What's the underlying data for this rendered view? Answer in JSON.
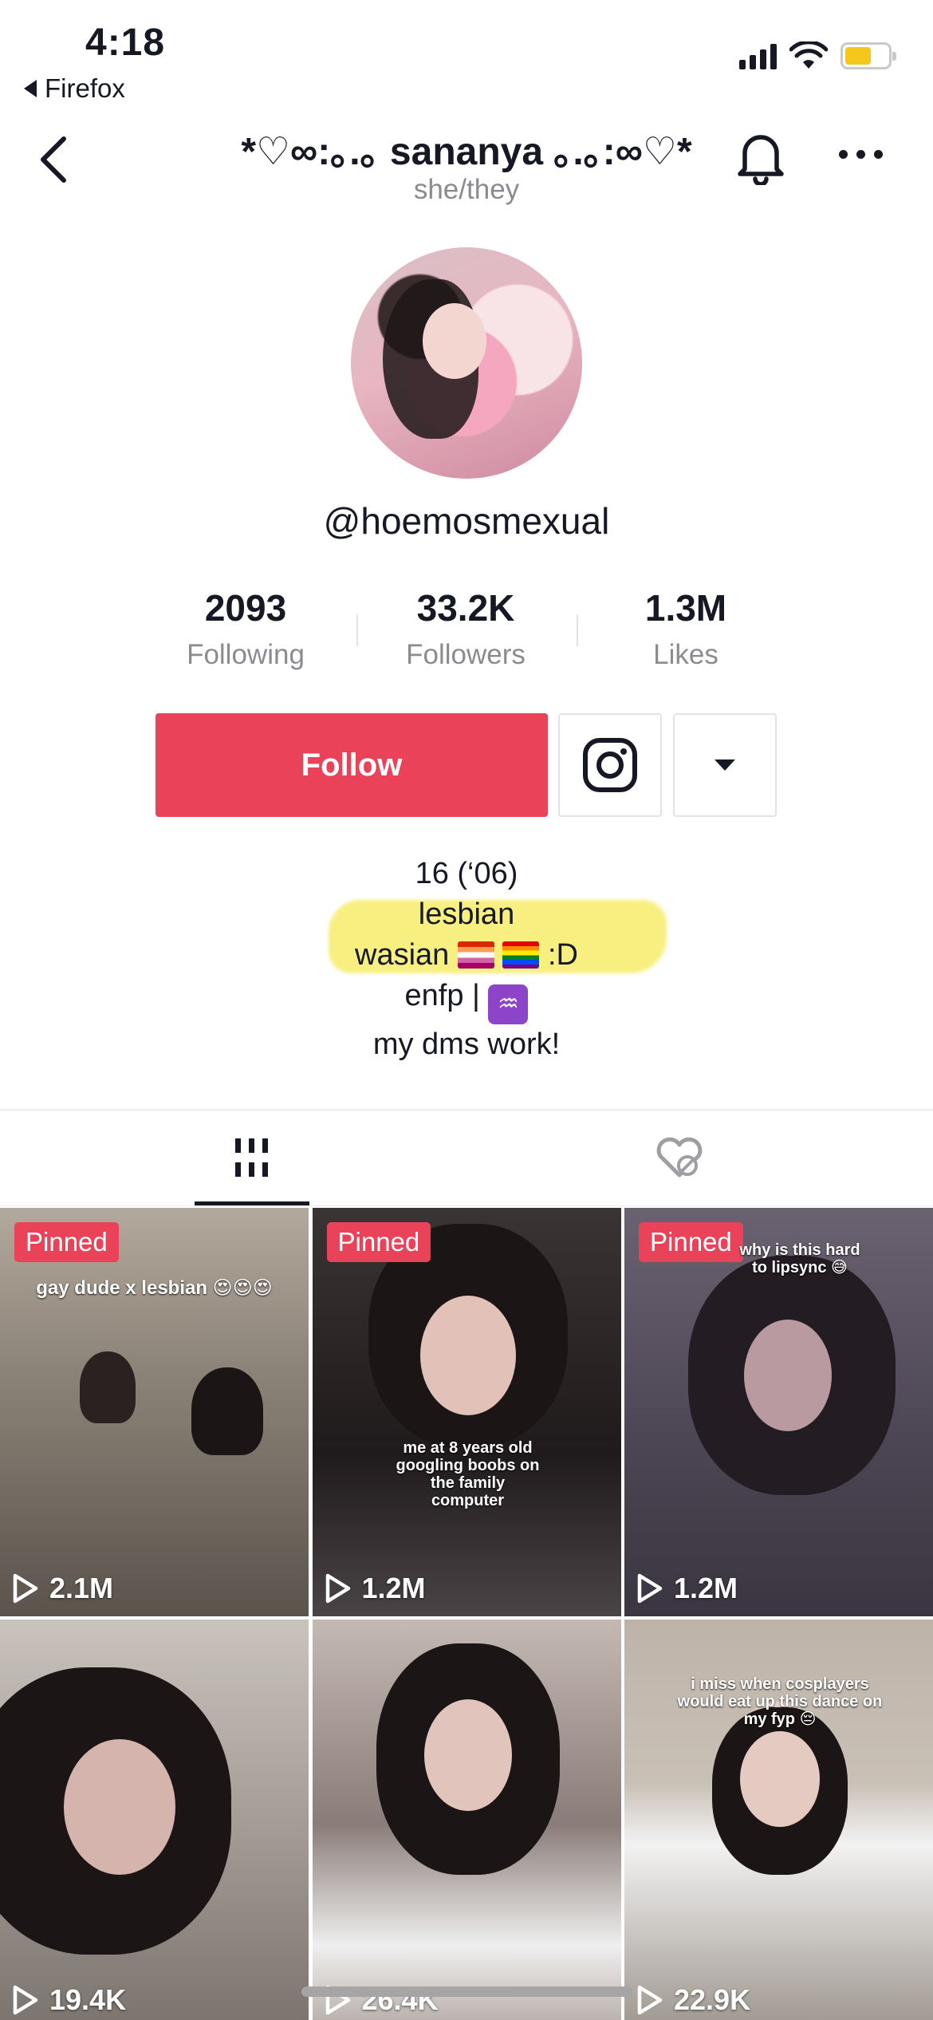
{
  "status_bar": {
    "time": "4:18",
    "back_app": "Firefox",
    "battery_color": "#f5c71a"
  },
  "header": {
    "title": "*♡∞:｡.｡ sananya ｡.｡:∞♡*",
    "pronouns": "she/they",
    "icons": [
      "back-chevron-icon",
      "bell-icon",
      "more-icon"
    ]
  },
  "profile": {
    "handle": "@hoemosmexual",
    "stats": [
      {
        "value": "2093",
        "label": "Following"
      },
      {
        "value": "33.2K",
        "label": "Followers"
      },
      {
        "value": "1.3M",
        "label": "Likes"
      }
    ]
  },
  "actions": {
    "follow_label": "Follow",
    "follow_color": "#ea4359",
    "instagram_icon": "instagram-icon",
    "dropdown_icon": "caret-down-icon"
  },
  "bio": {
    "line1": "16 (‘06)",
    "line2": "lesbian",
    "line3_text": "wasian",
    "line3_suffix": ":D",
    "line4_text": "enfp |",
    "aquarius_glyph": "♒",
    "line5": "my dms work!",
    "highlight_color": "#f7ee72"
  },
  "tabs": [
    {
      "icon": "videos-grid-icon",
      "active": true
    },
    {
      "icon": "liked-hidden-icon",
      "active": false
    }
  ],
  "videos": [
    {
      "pinned": "Pinned",
      "views": "2.1M",
      "caption": "gay dude x lesbian 😍😍😍"
    },
    {
      "pinned": "Pinned",
      "views": "1.2M",
      "caption": "me at 8 years old googling boobs on the family computer"
    },
    {
      "pinned": "Pinned",
      "views": "1.2M",
      "caption": "why is this hard to lipsync 😅"
    },
    {
      "pinned": "",
      "views": "19.4K",
      "caption": ""
    },
    {
      "pinned": "",
      "views": "26.4K",
      "caption": ""
    },
    {
      "pinned": "",
      "views": "22.9K",
      "caption": "i miss when cosplayers would eat up this dance on my fyp 😔"
    }
  ]
}
